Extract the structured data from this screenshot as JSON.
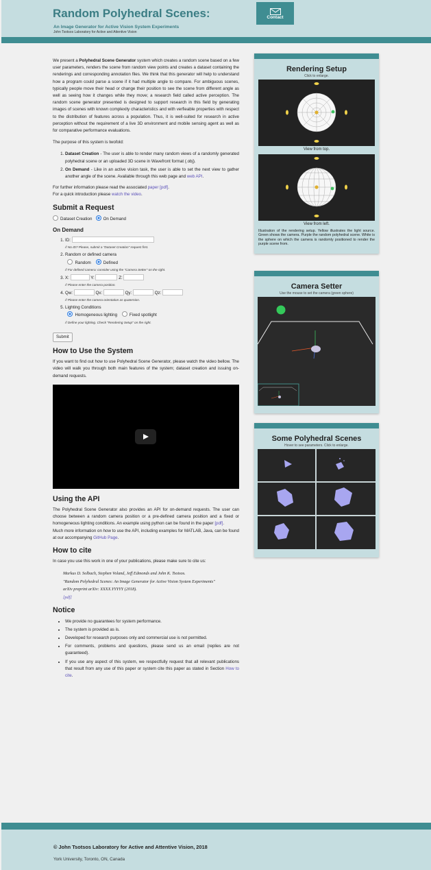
{
  "header": {
    "title": "Random Polyhedral Scenes:",
    "subtitle": "An Image Generator for Active Vision System Experiments",
    "lab": "John Tsotsos Laboratory for Active and Attentive Vision",
    "contact_label": "Contact",
    "contact_icon": "envelope-icon"
  },
  "intro": {
    "p1_before": "We present a ",
    "p1_bold": "Polyhedral Scene Generator",
    "p1_after": " system which creates a random scene based on a few user parameters, renders the scene from random view points and creates a dataset containing the renderings and corresponding annotation files. We think that this generator will help to understand how a program could parse a scene if it had multiple angle to compare. For ambiguous scenes, typically people move their head or change their position to see the scene from different angle as well as seeing how it changes while they move; a research field called active perception. The random scene generator presented is designed to support research in this field by generating images of scenes with known complexity characteristics and with verfieable properties with respect to the distribution of features across a population. Thus, it is well-suited for research in active perception without the requirement of a live 3D environment and mobile sensing agent as well as for comparative performance evaluations.",
    "p2": "The purpose of this system is twofold:",
    "li1_bold": "Dataset Creation",
    "li1_text": " - The user is able to render many random views of a randomly generated polyhedral scene or an uploaded 3D scene in Wavefront format (.obj).",
    "li2_bold": "On Demand",
    "li2_text": " - Like in an active vision task, the user is able to set the next view to gather another angle of the scene. Available through this web page and ",
    "li2_link": "web API",
    "li2_end": ".",
    "further_before": "For further information please read the associated ",
    "further_link": "paper [pdf]",
    "further_after": ".",
    "quick_before": "For a quick introduction please ",
    "quick_link": "watch the video",
    "quick_after": "."
  },
  "request": {
    "heading": "Submit a Request",
    "mode_dataset": "Dataset Creation",
    "mode_ondemand": "On Demand",
    "subheading": "On Demand",
    "id_label": "ID:",
    "id_hint": "// No ID? Please, submit a \"Dataset Creation\" request first.",
    "camera_label": "Random or defined camera",
    "camera_random": "Random",
    "camera_defined": "Defined",
    "camera_hint": "// For defined camera: consider using the \"Camera Setter\" on the right.",
    "x_label": "X:",
    "y_label": "Y:",
    "z_label": "Z:",
    "pos_hint": "// Please enter the camera position.",
    "qw_label": "Qw:",
    "qx_label": "Qx:",
    "qy_label": "Qy:",
    "qz_label": "Qz:",
    "quat_hint": "// Please enter the camera orientation as quaternion.",
    "lighting_label": "Lighting Conditions",
    "lighting_homog": "Homogeneous lighting",
    "lighting_fixed": "Fixed spotlight",
    "lighting_hint": "// Define your lighting. Check \"Rendering Setup\" on the right.",
    "submit_label": "Submit"
  },
  "howto": {
    "heading": "How to Use the System",
    "text": "If you want to find out how to use Polyhedral Scene Generator, please watch the video bellow. The video will walk you through both main features of the system; dataset creation and issuing on-demand requests."
  },
  "api": {
    "heading": "Using the API",
    "p1_before": "The Polyhedral Scene Generator also provides an API for on-demand requests. The user can choose between a random camera position or a pre-defined camera position and a fixed or homogeneous lighting conditions. An example using python can be found in the paper ",
    "p1_link": "[pdf]",
    "p1_after": ".",
    "p2_before": "Much more information on how to use the API, including examples for MATLAB, Java, can be found at our accompanying ",
    "p2_link": "GitHub Page",
    "p2_after": "."
  },
  "cite": {
    "heading": "How to cite",
    "intro": "In case you use this work in one of your publications, please make sure to cite us:",
    "authors": "Markus D. Solbach, Stephen Voland, Jeff Edmonds and John K. Tsotsos.",
    "title": "\"Random Polyhedral Scenes: An Image Generator for Active Vision System Experiments\"",
    "venue": "arXiv preprint arXiv: XXXX.YYYYY (2018).",
    "pdf": "[pdf]"
  },
  "notice": {
    "heading": "Notice",
    "items": [
      "We provide no guarantees for system performance.",
      "The system is provided as is.",
      "Developed for research purposes only and commercial use is not permitted.",
      "For comments, problems and questions, please send us an email (replies are not guaranteed)."
    ],
    "last_before": "If you use any aspect of this system, we respectfully request that all relevant publications that result from any use of this paper or system cite this paper as stated in Section ",
    "last_link": "How to cite",
    "last_after": "."
  },
  "rendering": {
    "title": "Rendering Setup",
    "subtitle": "Click to enlarge.",
    "caption_top": "View from top.",
    "caption_left": "View from left.",
    "description": "Illustration of the rendering setup. Yellow illustrates the light source. Green shows the camera. Purple the random polyhedral scene. White is the sphere on which the camera is randomly positioned to render the purple scene from."
  },
  "camera_setter": {
    "title": "Camera Setter",
    "subtitle": "Use the mouse to set the camera (green sphere)"
  },
  "scenes": {
    "title": "Some Polyhedral Scenes",
    "subtitle": "Hover to see parameters. Click to enlarge."
  },
  "footer": {
    "copyright": "© John Tsotsos Laboratory for Active and Attentive Vision, 2018",
    "address": "York University, Toronto, ON, Canada"
  },
  "colors": {
    "header_bg": "#c5dde0",
    "accent": "#3f8d92",
    "title": "#3b7d84",
    "link": "#5a4fb8",
    "scene_purple": "#a8a6f0"
  }
}
